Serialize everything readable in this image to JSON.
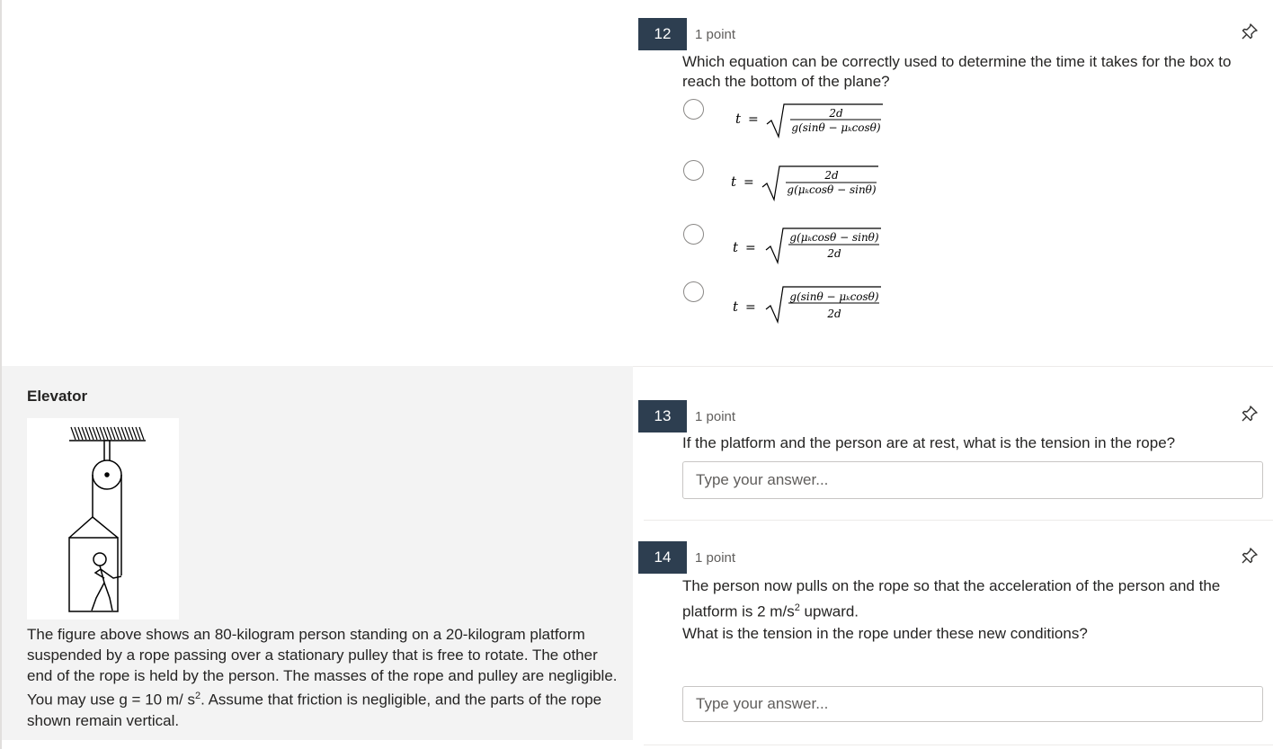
{
  "questions": [
    {
      "number": "12",
      "points": "1 point",
      "text": "Which equation can be correctly used to determine the time it takes for the box to reach the bottom of the plane?",
      "options": [
        {
          "lhs": "t",
          "eq": "=",
          "numerator": "2d",
          "denominator": "g(sinθ − μₖcosθ)"
        },
        {
          "lhs": "t",
          "eq": "=",
          "numerator": "2d",
          "denominator": "g(μₖcosθ − sinθ)"
        },
        {
          "lhs": "t",
          "eq": "=",
          "numerator": "g(μₖcosθ − sinθ)",
          "denominator": "2d"
        },
        {
          "lhs": "t",
          "eq": "=",
          "numerator": "g(sinθ − μₖcosθ)",
          "denominator": "2d"
        }
      ]
    },
    {
      "number": "13",
      "points": "1 point",
      "text": "If the platform and the person are at rest, what is the tension in the rope?",
      "placeholder": "Type your answer..."
    },
    {
      "number": "14",
      "points": "1 point",
      "text_line1": "The person now pulls on the rope so that the acceleration of the person and the platform is 2 m/s",
      "text_sup": "2",
      "text_line1_end": " upward.",
      "text_line2": "What is the tension in the rope under these new conditions?",
      "placeholder": "Type your answer..."
    }
  ],
  "section": {
    "title": "Elevator",
    "text_part1": "The figure above shows an 80-kilogram person standing on a 20-kilogram platform suspended by a rope passing over a stationary pulley that is free to rotate.  The other end of the rope is held by the person. The masses of the rope and pulley are negligible.  You may use g = 10 m/ s",
    "text_sup": "2",
    "text_part2": ".  Assume that friction is negligible, and the parts of the rope shown remain vertical."
  },
  "icons": {
    "pin": "pin-icon"
  },
  "colors": {
    "number_badge": "#2d3e50",
    "panel": "#f3f3f3"
  }
}
